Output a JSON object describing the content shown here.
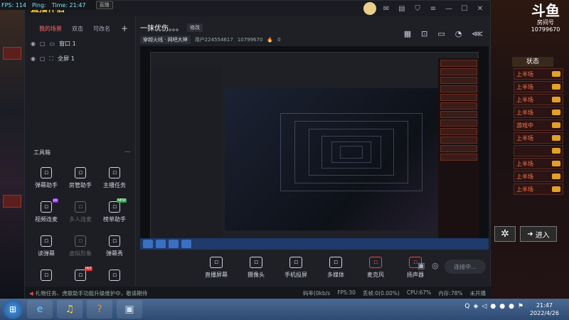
{
  "hud": {
    "fps": "FPS: 114",
    "ping": "Ping:",
    "time": "Time: 21:47",
    "tag": "直播"
  },
  "app": {
    "logo": "直播伴侣",
    "tabs": [
      "我的场景",
      "双击",
      "可改名"
    ],
    "scenes": [
      {
        "label": "窗口 1"
      },
      {
        "label": "全屏 1"
      }
    ],
    "toolbox_title": "工具箱",
    "tools": [
      {
        "label": "弹幕助手",
        "icon": "danmu-icon",
        "dim": false,
        "badge": ""
      },
      {
        "label": "房管助手",
        "icon": "user-admin-icon",
        "dim": false,
        "badge": ""
      },
      {
        "label": "主播任务",
        "icon": "task-icon",
        "dim": false,
        "badge": ""
      },
      {
        "label": "视频连麦",
        "icon": "video-link-icon",
        "dim": false,
        "badge": "pk"
      },
      {
        "label": "多人连麦",
        "icon": "multi-link-icon",
        "dim": true,
        "badge": ""
      },
      {
        "label": "榜单助手",
        "icon": "rank-icon",
        "dim": false,
        "badge": "NEW"
      },
      {
        "label": "读弹幕",
        "icon": "read-danmu-icon",
        "dim": false,
        "badge": ""
      },
      {
        "label": "虚拟形象",
        "icon": "avatar-virtual-icon",
        "dim": true,
        "badge": ""
      },
      {
        "label": "弹幕秀",
        "icon": "danmu-show-icon",
        "dim": false,
        "badge": ""
      },
      {
        "label": "",
        "icon": "more-tool-icon",
        "dim": false,
        "badge": ""
      },
      {
        "label": "",
        "icon": "pk-tool-icon",
        "dim": false,
        "badge": "PKT"
      },
      {
        "label": "",
        "icon": "download-tool-icon",
        "dim": false,
        "badge": ""
      }
    ],
    "header": {
      "title": "一抹优伤。。。",
      "modify_btn": "修改",
      "game": "穿越火线 · 网吧大神",
      "user_id": "用户224554617",
      "room_id": "10799670",
      "hot": "0"
    },
    "actions": [
      {
        "label": "直播屏幕",
        "icon": "screen-share-icon",
        "red": false
      },
      {
        "label": "摄像头",
        "icon": "camera-icon",
        "red": false
      },
      {
        "label": "手机投屏",
        "icon": "phone-cast-icon",
        "red": false
      },
      {
        "label": "多媒体",
        "icon": "media-icon",
        "red": false
      },
      {
        "label": "麦克风",
        "icon": "microphone-icon",
        "red": true
      },
      {
        "label": "扬声器",
        "icon": "speaker-icon",
        "red": true
      }
    ],
    "live_button": "连接中...",
    "status": {
      "message": "礼物任务、虎歌助手功能升级维护中，敬请期待",
      "bitrate": "码率(0kb/s",
      "fps": "FPS:30",
      "drop": "丢帧:0(0.00%)",
      "cpu": "CPU:67%",
      "mem": "内存:78%",
      "record": "未开播"
    }
  },
  "game_right": {
    "logo_big": "斗鱼",
    "room_label": "房间号",
    "room_num": "10799670",
    "status_title": "状态",
    "rows": [
      "上半场",
      "上半场",
      "上半场",
      "上半场",
      "游戏中",
      "上半场",
      "",
      "上半场",
      "上半场",
      "上半场"
    ],
    "enter": "进入"
  },
  "taskbar": {
    "time": "21:47",
    "date": "2022/4/26"
  }
}
